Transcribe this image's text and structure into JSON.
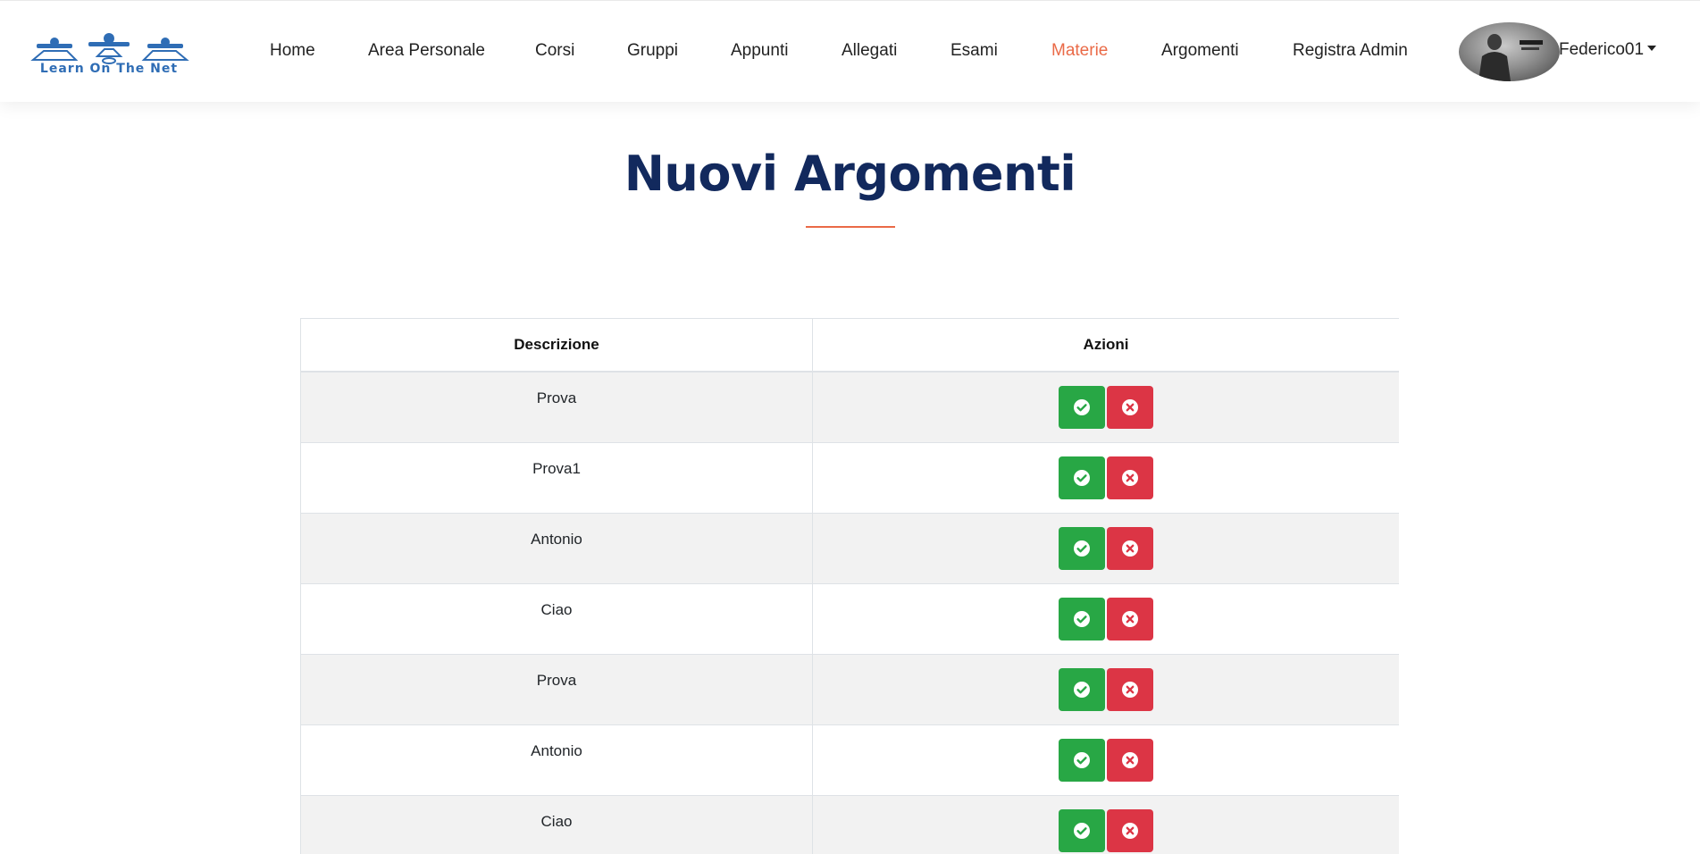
{
  "header": {
    "logo_text": "Learn On The Net",
    "nav": [
      {
        "label": "Home"
      },
      {
        "label": "Area Personale"
      },
      {
        "label": "Corsi"
      },
      {
        "label": "Gruppi"
      },
      {
        "label": "Appunti"
      },
      {
        "label": "Allegati"
      },
      {
        "label": "Esami"
      },
      {
        "label": "Materie"
      },
      {
        "label": "Argomenti"
      },
      {
        "label": "Registra Admin"
      }
    ],
    "active_item": "Materie",
    "user": "Federico01"
  },
  "page": {
    "title": "Nuovi Argomenti"
  },
  "table": {
    "headers": [
      "Descrizione",
      "Azioni"
    ],
    "rows": [
      {
        "descrizione": "Prova"
      },
      {
        "descrizione": "Prova1"
      },
      {
        "descrizione": "Antonio"
      },
      {
        "descrizione": "Ciao"
      },
      {
        "descrizione": "Prova"
      },
      {
        "descrizione": "Antonio"
      },
      {
        "descrizione": "Ciao"
      }
    ],
    "actions": [
      "check-circle-icon",
      "times-circle-icon"
    ]
  },
  "colors": {
    "accent": "#ea6a47",
    "title": "#12295d",
    "approve": "#28a745",
    "reject": "#dc3545"
  }
}
